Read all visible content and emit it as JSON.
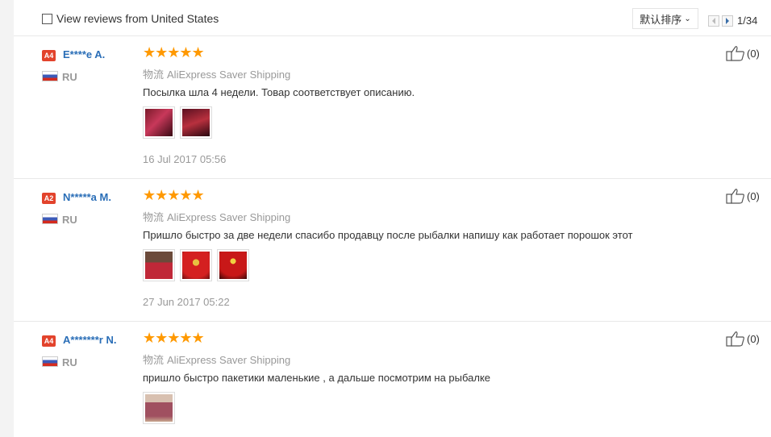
{
  "toolbar": {
    "filter_label": "View reviews from United States",
    "sort_label": "默认排序",
    "page_indicator": "1/34"
  },
  "reviews": [
    {
      "badge": "A4",
      "user": "E****e A.",
      "country": "RU",
      "stars": "★★★★★",
      "shipping_label": "物流",
      "shipping": "AliExpress Saver Shipping",
      "text": "Посылка шла 4 недели. Товар соответствует описанию.",
      "photos": 2,
      "date": "16 Jul 2017 05:56",
      "likes": "(0)"
    },
    {
      "badge": "A2",
      "user": "N*****a M.",
      "country": "RU",
      "stars": "★★★★★",
      "shipping_label": "物流",
      "shipping": "AliExpress Saver Shipping",
      "text": "Пришло быстро за две недели спасибо продавцу после рыбалки напишу как работает порошок этот",
      "photos": 3,
      "date": "27 Jun 2017 05:22",
      "likes": "(0)"
    },
    {
      "badge": "A4",
      "user": "A*******r N.",
      "country": "RU",
      "stars": "★★★★★",
      "shipping_label": "物流",
      "shipping": "AliExpress Saver Shipping",
      "text": "пришло быстро пакетики маленькие , а дальше посмотрим на рыбалке",
      "photos": 1,
      "date": "",
      "likes": "(0)"
    }
  ]
}
